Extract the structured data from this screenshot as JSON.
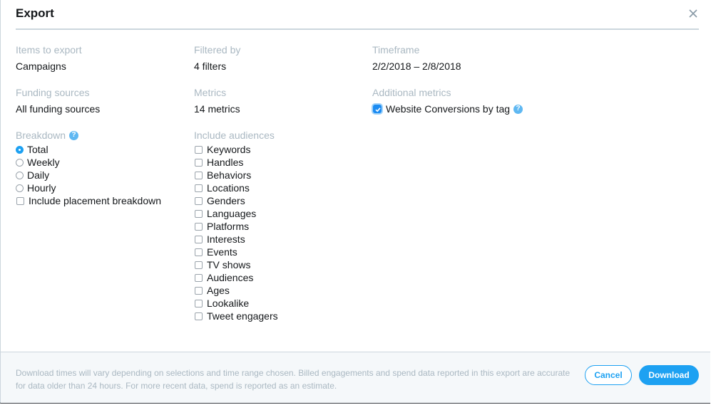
{
  "modal": {
    "title": "Export",
    "close_icon": "close-icon"
  },
  "summary": {
    "items_to_export": {
      "label": "Items to export",
      "value": "Campaigns"
    },
    "filtered_by": {
      "label": "Filtered by",
      "value": "4 filters"
    },
    "timeframe": {
      "label": "Timeframe",
      "value": "2/2/2018 – 2/8/2018"
    },
    "funding_sources": {
      "label": "Funding sources",
      "value": "All funding sources"
    },
    "metrics": {
      "label": "Metrics",
      "value": "14 metrics"
    }
  },
  "additional_metrics": {
    "label": "Additional metrics",
    "options": [
      {
        "label": "Website Conversions by tag",
        "checked": true,
        "help_icon": "?"
      }
    ]
  },
  "breakdown": {
    "label": "Breakdown",
    "help_icon": "?",
    "selected": "Total",
    "radios": [
      {
        "label": "Total",
        "checked": true
      },
      {
        "label": "Weekly",
        "checked": false
      },
      {
        "label": "Daily",
        "checked": false
      },
      {
        "label": "Hourly",
        "checked": false
      }
    ],
    "placement": {
      "label": "Include placement breakdown",
      "checked": false
    }
  },
  "audiences": {
    "label": "Include audiences",
    "options": [
      {
        "label": "Keywords",
        "checked": false
      },
      {
        "label": "Handles",
        "checked": false
      },
      {
        "label": "Behaviors",
        "checked": false
      },
      {
        "label": "Locations",
        "checked": false
      },
      {
        "label": "Genders",
        "checked": false
      },
      {
        "label": "Languages",
        "checked": false
      },
      {
        "label": "Platforms",
        "checked": false
      },
      {
        "label": "Interests",
        "checked": false
      },
      {
        "label": "Events",
        "checked": false
      },
      {
        "label": "TV shows",
        "checked": false
      },
      {
        "label": "Audiences",
        "checked": false
      },
      {
        "label": "Ages",
        "checked": false
      },
      {
        "label": "Lookalike",
        "checked": false
      },
      {
        "label": "Tweet engagers",
        "checked": false
      }
    ]
  },
  "footer": {
    "note_line1": "Download times will vary depending on selections and time range chosen. Billed engagements and spend data reported in this export are accurate",
    "note_line2": "for data older than 24 hours. For more recent data, spend is reported as an estimate.",
    "cancel_label": "Cancel",
    "download_label": "Download"
  },
  "colors": {
    "accent": "#1da1f2",
    "label_gray": "#aab8c2",
    "divider": "#ccd6dd",
    "footer_bg": "#f5f8fa"
  }
}
